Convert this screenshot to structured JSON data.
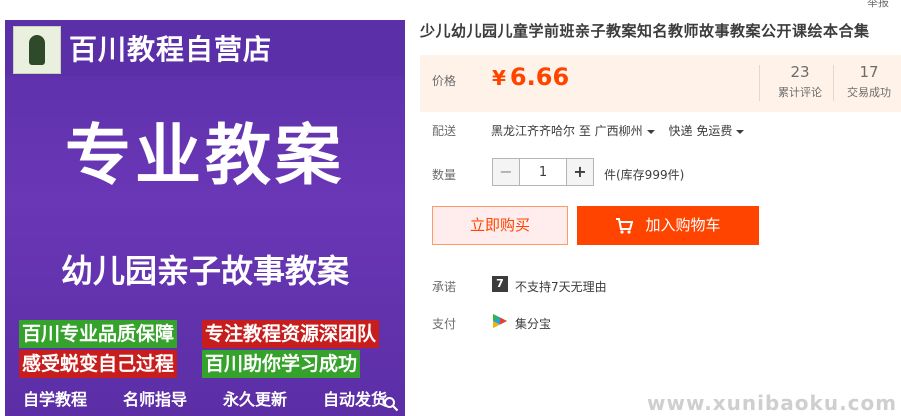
{
  "header": {
    "report": "举报"
  },
  "product_image": {
    "shop_name": "百川教程自营店",
    "headline": "专业教案",
    "subtitle": "幼儿园亲子故事教案",
    "features": [
      "百川专业品质保障",
      "专注教程资源深团队",
      "感受蜕变自己过程",
      "百川助你学习成功"
    ],
    "services": [
      "自学教程",
      "名师指导",
      "永久更新",
      "自动发货"
    ],
    "zoom_icon": "search-icon"
  },
  "product": {
    "title": "少儿幼儿园儿童学前班亲子教案知名教师故事教案公开课绘本合集"
  },
  "price_panel": {
    "label": "价格",
    "currency": "¥",
    "price": "6.66",
    "reviews_count": "23",
    "reviews_label": "累计评论",
    "sales_count": "17",
    "sales_label": "交易成功"
  },
  "delivery": {
    "label": "配送",
    "from": "黑龙江齐齐哈尔 至",
    "to": "广西柳州",
    "method": "快递 免运费"
  },
  "quantity": {
    "label": "数量",
    "minus": "−",
    "value": "1",
    "plus": "+",
    "stock": "件(库存999件)"
  },
  "actions": {
    "buy_now": "立即购买",
    "add_cart": "加入购物车"
  },
  "promise": {
    "label": "承诺",
    "icon_text": "7",
    "text": "不支持7天无理由"
  },
  "payment": {
    "label": "支付",
    "text": "集分宝"
  },
  "watermark": "www.xunibaoku.com",
  "colors": {
    "accent": "#ff4400",
    "price_bg": "#fff2e8",
    "image_bg": "#5a2fa8"
  }
}
